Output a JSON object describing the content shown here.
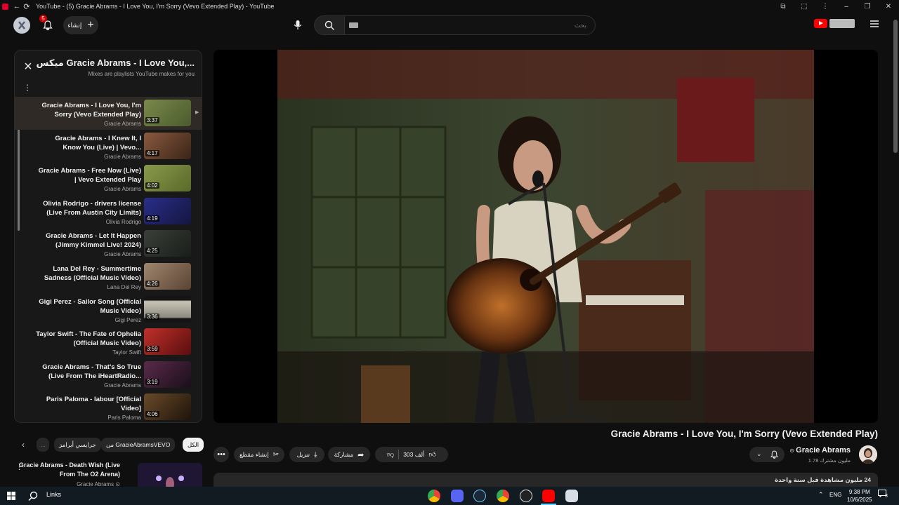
{
  "window": {
    "title": "YouTube - (5) Gracie Abrams - I Love You, I'm Sorry (Vevo Extended Play) - YouTube"
  },
  "topbar": {
    "notification_count": "5",
    "create_label": "إنشاء",
    "search_placeholder": "بحث"
  },
  "playlist": {
    "title": "ميكس Gracie Abrams - I Love You,...",
    "subtitle": "Mixes are playlists YouTube makes for you",
    "items": [
      {
        "title": "Gracie Abrams - I Love You, I'm Sorry (Vevo Extended Play)",
        "channel": "Gracie Abrams",
        "duration": "3:37",
        "thumb": "#5b6a3e"
      },
      {
        "title": "Gracie Abrams - I Knew It, I Know You (Live) | Vevo...",
        "channel": "Gracie Abrams",
        "duration": "4:17",
        "thumb": "#6a4a34"
      },
      {
        "title": "Gracie Abrams - Free Now (Live) | Vevo Extended Play",
        "channel": "Gracie Abrams",
        "duration": "4:02",
        "thumb": "#687a3a"
      },
      {
        "title": "Olivia Rodrigo - drivers license (Live From Austin City Limits)",
        "channel": "Olivia Rodrigo",
        "duration": "4:19",
        "thumb": "#1d1f5a"
      },
      {
        "title": "Gracie Abrams - Let It Happen (Jimmy Kimmel Live! 2024)",
        "channel": "Gracie Abrams",
        "duration": "4:25",
        "thumb": "#2a2f2a"
      },
      {
        "title": "Lana Del Rey - Summertime Sadness (Official Music Video)",
        "channel": "Lana Del Rey",
        "duration": "4:26",
        "thumb": "#6e5a48"
      },
      {
        "title": "Gigi Perez - Sailor Song (Official Music Video)",
        "channel": "Gigi Perez",
        "duration": "3:36",
        "thumb": "#141414"
      },
      {
        "title": "Taylor Swift - The Fate of Ophelia (Official Music Video)",
        "channel": "Taylor Swift",
        "duration": "3:59",
        "thumb": "#9a1f1f"
      },
      {
        "title": "Gracie Abrams - That's So True (Live From The iHeartRadio...",
        "channel": "Gracie Abrams",
        "duration": "3:19",
        "thumb": "#3a1a2e"
      },
      {
        "title": "Paris Paloma - labour [Official Video]",
        "channel": "Paris Paloma",
        "duration": "4:06",
        "thumb": "#3a2a1a"
      }
    ]
  },
  "chips": {
    "all": "الكل",
    "from_channel": "من GracieAbramsVEVO",
    "related": "جرايسي أبرامز",
    "more": "..."
  },
  "next_video": {
    "title": "Gracie Abrams - Death Wish (Live From The O2 Arena)",
    "channel": "Gracie Abrams"
  },
  "video": {
    "title": "Gracie Abrams - I Love You, I'm Sorry (Vevo Extended Play)",
    "channel_name": "Gracie Abrams",
    "subscribers": "1.78 مليون مشترك",
    "likes": "303 ألف",
    "share_label": "مشاركة",
    "download_label": "تنزيل",
    "clip_label": "إنشاء مقطع",
    "views": "24 مليون مشاهدة",
    "age": "قبل سنة واحدة"
  },
  "taskbar": {
    "search_label": "Links",
    "language": "ENG",
    "time": "9:38 PM",
    "date": "10/6/2025",
    "notification_count": "3"
  },
  "colors": {
    "background": "#0f0f0f",
    "surface": "#272727",
    "accent_red": "#ff0000",
    "taskbar": "#121b22"
  }
}
